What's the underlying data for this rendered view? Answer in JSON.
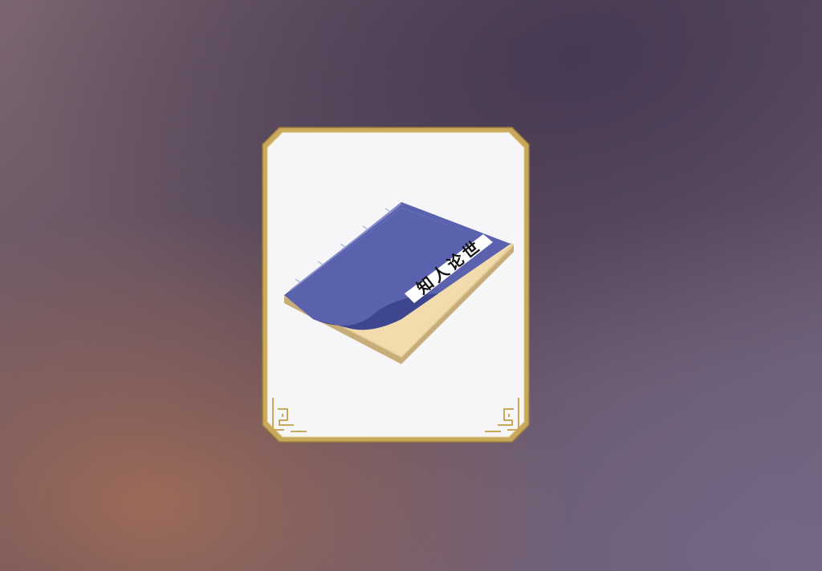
{
  "item_card": {
    "book": {
      "title_text": "知人论世"
    }
  },
  "colors": {
    "frame_gold": "#c8a85a",
    "frame_gold_dark": "#9a7c3c",
    "card_inner": "#f6f5f8",
    "book_cover": "#5a62ae",
    "book_cover_dark": "#3f4690",
    "book_pages": "#f2dcae",
    "book_pages_edge": "#c9ad78",
    "label_bg": "#ffffff",
    "binding": "#8a90cc"
  }
}
